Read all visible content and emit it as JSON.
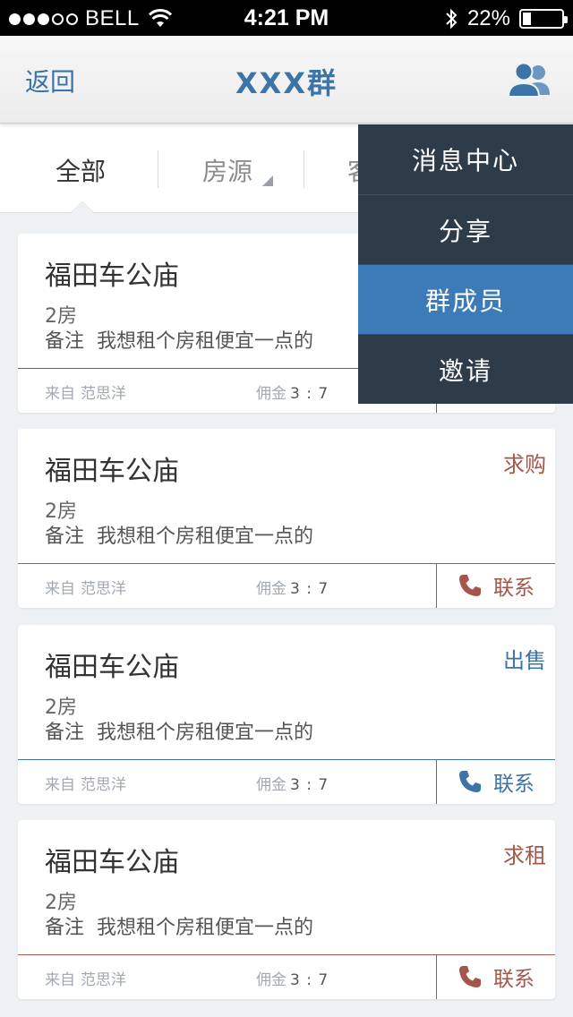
{
  "status_bar": {
    "carrier": "BELL",
    "time": "4:21 PM",
    "battery_text": "22%",
    "battery_level": 0.22,
    "signal_bars_filled": 3,
    "signal_bars_total": 5
  },
  "nav": {
    "back_label": "返回",
    "title": "XXX群",
    "members_icon": "group-members-icon",
    "accent": "#3a74a8"
  },
  "filter": {
    "tabs": [
      {
        "label": "全部",
        "active": true
      },
      {
        "label": "房源",
        "active": false
      },
      {
        "label": "客",
        "active": false
      }
    ]
  },
  "menu": {
    "items": [
      {
        "label": "消息中心",
        "highlighted": false
      },
      {
        "label": "分享",
        "highlighted": false
      },
      {
        "label": "群成员",
        "highlighted": true
      },
      {
        "label": "邀请",
        "highlighted": false
      }
    ],
    "bg": "#2e3b49",
    "highlight": "#3d7ab8"
  },
  "cards": [
    {
      "title": "福田车公庙",
      "tag": "",
      "rooms": "2房",
      "note_label": "备注",
      "note": "我想租个房租便宜一点的",
      "from_label": "来自",
      "from_name": "范思洋",
      "commission_label": "佣金",
      "commission": "3 : 7",
      "contact_label": "",
      "accent": "#3a74a8"
    },
    {
      "title": "福田车公庙",
      "tag": "求购",
      "rooms": "2房",
      "note_label": "备注",
      "note": "我想租个房租便宜一点的",
      "from_label": "来自",
      "from_name": "范思洋",
      "commission_label": "佣金",
      "commission": "3 : 7",
      "contact_label": "联系",
      "accent": "#a4564b"
    },
    {
      "title": "福田车公庙",
      "tag": "出售",
      "rooms": "2房",
      "note_label": "备注",
      "note": "我想租个房租便宜一点的",
      "from_label": "来自",
      "from_name": "范思洋",
      "commission_label": "佣金",
      "commission": "3 : 7",
      "contact_label": "联系",
      "accent": "#3a74a8"
    },
    {
      "title": "福田车公庙",
      "tag": "求租",
      "rooms": "2房",
      "note_label": "备注",
      "note": "我想租个房租便宜一点的",
      "from_label": "来自",
      "from_name": "范思洋",
      "commission_label": "佣金",
      "commission": "3 : 7",
      "contact_label": "联系",
      "accent": "#a4564b"
    }
  ]
}
